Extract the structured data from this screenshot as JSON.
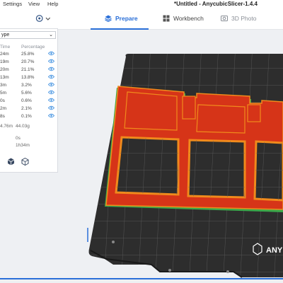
{
  "menu": [
    "Settings",
    "View",
    "Help"
  ],
  "window_title": "*Untitled - AnycubicSlicer-1.4.4",
  "tabs": [
    {
      "label": "Prepare",
      "icon": "cube-stack-icon"
    },
    {
      "label": "Workbench",
      "icon": "grid-icon"
    },
    {
      "label": "3D Photo",
      "icon": "photo-icon"
    }
  ],
  "panel": {
    "type_select": "ype",
    "headers": {
      "time": "Time",
      "percentage": "Percentage"
    },
    "rows": [
      {
        "time": "24m",
        "percentage": "25.8%"
      },
      {
        "time": "19m",
        "percentage": "20.7%"
      },
      {
        "time": "20m",
        "percentage": "21.1%"
      },
      {
        "time": "13m",
        "percentage": "13.8%"
      },
      {
        "time": "3m",
        "percentage": "3.2%"
      },
      {
        "time": "5m",
        "percentage": "5.6%"
      },
      {
        "time": "0s",
        "percentage": "0.6%"
      },
      {
        "time": "2m",
        "percentage": "2.1%"
      },
      {
        "time": "8s",
        "percentage": "0.1%"
      }
    ],
    "filament_length": "4.76m",
    "filament_weight": "44.03g",
    "prepare_time": "0s",
    "total_time": "1h34m"
  },
  "bed_brand": "ANY",
  "colors": {
    "accent": "#2a6fd8",
    "bed": "#2d2d2d",
    "model_outer": "#f08a1c",
    "model_inner": "#d63418",
    "support": "#3aa84a"
  }
}
